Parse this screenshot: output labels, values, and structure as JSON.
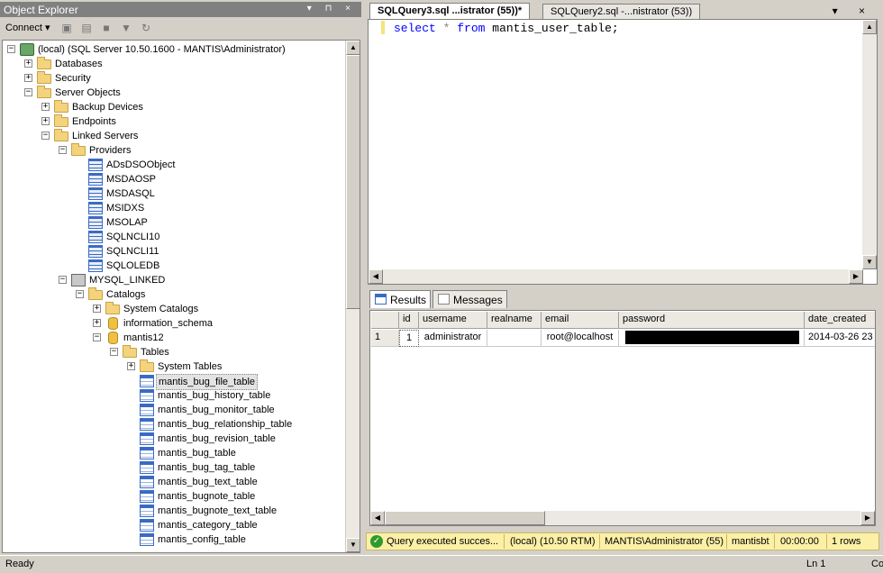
{
  "object_explorer": {
    "title": "Object Explorer",
    "controls": [
      "▾",
      "⊓",
      "×"
    ],
    "toolbar": {
      "connect": "Connect ▾"
    },
    "tree": [
      {
        "label": "(local) (SQL Server 10.50.1600 - MANTIS\\Administrator)",
        "icon": "server-icon",
        "level": 0,
        "expander": "−"
      },
      {
        "label": "Databases",
        "icon": "folder-icon",
        "level": 1,
        "expander": "+"
      },
      {
        "label": "Security",
        "icon": "folder-icon",
        "level": 1,
        "expander": "+"
      },
      {
        "label": "Server Objects",
        "icon": "folder-icon",
        "level": 1,
        "expander": "−"
      },
      {
        "label": "Backup Devices",
        "icon": "folder-icon",
        "level": 2,
        "expander": "+"
      },
      {
        "label": "Endpoints",
        "icon": "folder-icon",
        "level": 2,
        "expander": "+"
      },
      {
        "label": "Linked Servers",
        "icon": "folder-icon",
        "level": 2,
        "expander": "−"
      },
      {
        "label": "Providers",
        "icon": "folder-icon",
        "level": 3,
        "expander": "−"
      },
      {
        "label": "ADsDSOObject",
        "icon": "provider-icon",
        "level": 4,
        "expander": ""
      },
      {
        "label": "MSDAOSP",
        "icon": "provider-icon",
        "level": 4,
        "expander": ""
      },
      {
        "label": "MSDASQL",
        "icon": "provider-icon",
        "level": 4,
        "expander": ""
      },
      {
        "label": "MSIDXS",
        "icon": "provider-icon",
        "level": 4,
        "expander": ""
      },
      {
        "label": "MSOLAP",
        "icon": "provider-icon",
        "level": 4,
        "expander": ""
      },
      {
        "label": "SQLNCLI10",
        "icon": "provider-icon",
        "level": 4,
        "expander": ""
      },
      {
        "label": "SQLNCLI11",
        "icon": "provider-icon",
        "level": 4,
        "expander": ""
      },
      {
        "label": "SQLOLEDB",
        "icon": "provider-icon",
        "level": 4,
        "expander": ""
      },
      {
        "label": "MYSQL_LINKED",
        "icon": "linked-server-icon",
        "level": 3,
        "expander": "−"
      },
      {
        "label": "Catalogs",
        "icon": "folder-icon",
        "level": 4,
        "expander": "−"
      },
      {
        "label": "System Catalogs",
        "icon": "folder-icon",
        "level": 5,
        "expander": "+"
      },
      {
        "label": "information_schema",
        "icon": "database-icon",
        "level": 5,
        "expander": "+"
      },
      {
        "label": "mantis12",
        "icon": "database-icon",
        "level": 5,
        "expander": "−"
      },
      {
        "label": "Tables",
        "icon": "folder-icon",
        "level": 6,
        "expander": "−"
      },
      {
        "label": "System Tables",
        "icon": "folder-icon",
        "level": 7,
        "expander": "+"
      },
      {
        "label": "mantis_bug_file_table",
        "icon": "table-icon",
        "level": 7,
        "expander": "",
        "selected": true
      },
      {
        "label": "mantis_bug_history_table",
        "icon": "table-icon",
        "level": 7,
        "expander": ""
      },
      {
        "label": "mantis_bug_monitor_table",
        "icon": "table-icon",
        "level": 7,
        "expander": ""
      },
      {
        "label": "mantis_bug_relationship_table",
        "icon": "table-icon",
        "level": 7,
        "expander": ""
      },
      {
        "label": "mantis_bug_revision_table",
        "icon": "table-icon",
        "level": 7,
        "expander": ""
      },
      {
        "label": "mantis_bug_table",
        "icon": "table-icon",
        "level": 7,
        "expander": ""
      },
      {
        "label": "mantis_bug_tag_table",
        "icon": "table-icon",
        "level": 7,
        "expander": ""
      },
      {
        "label": "mantis_bug_text_table",
        "icon": "table-icon",
        "level": 7,
        "expander": ""
      },
      {
        "label": "mantis_bugnote_table",
        "icon": "table-icon",
        "level": 7,
        "expander": ""
      },
      {
        "label": "mantis_bugnote_text_table",
        "icon": "table-icon",
        "level": 7,
        "expander": ""
      },
      {
        "label": "mantis_category_table",
        "icon": "table-icon",
        "level": 7,
        "expander": ""
      },
      {
        "label": "mantis_config_table",
        "icon": "table-icon",
        "level": 7,
        "expander": ""
      }
    ]
  },
  "doc_tabs": {
    "active": "SQLQuery3.sql ...istrator (55))*",
    "inactive": "SQLQuery2.sql -...nistrator (53))",
    "controls": "▾ ×"
  },
  "editor": {
    "kw_select": "select",
    "op_star": "*",
    "kw_from": "from",
    "ident": "mantis_user_table;"
  },
  "results_tabs": {
    "results": "Results",
    "messages": "Messages"
  },
  "grid": {
    "columns": [
      "",
      "id",
      "username",
      "realname",
      "email",
      "password",
      "date_created"
    ],
    "rows": [
      [
        "1",
        "1",
        "administrator",
        "",
        "root@localhost",
        "",
        "2014-03-26 23"
      ]
    ]
  },
  "status_strip": {
    "message": "Query executed succes...",
    "server": "(local) (10.50 RTM)",
    "user": "MANTIS\\Administrator (55)",
    "database": "mantisbt",
    "time": "00:00:00",
    "rows": "1 rows"
  },
  "statusbar": {
    "left": "Ready",
    "line": "Ln 1",
    "col": "Co"
  },
  "colors": {
    "status_yellow": "#fbf0a6",
    "keyword_blue": "#0000ff",
    "ok_green": "#2e9a2e"
  }
}
